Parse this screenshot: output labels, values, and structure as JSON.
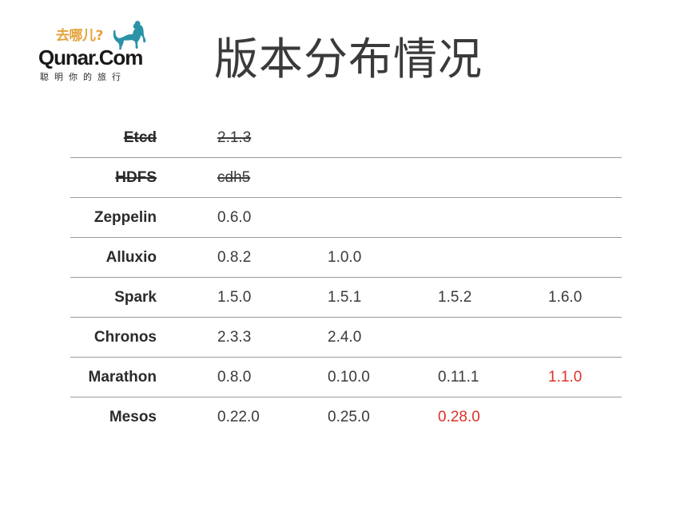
{
  "logo": {
    "slogan_cn": "去哪儿?",
    "wordmark": "Qunar.Com",
    "tagline": "聪明你的旅行",
    "camel_color": "#2a93a8",
    "slogan_color": "#e3a33c"
  },
  "header": {
    "title": "版本分布情况",
    "title_color": "#3a3a3a"
  },
  "colors": {
    "background": "#ffffff",
    "rule": "#9a9a9a",
    "text": "#3a3a3a",
    "label": "#2b2b2b",
    "highlight": "#e03127"
  },
  "table": {
    "rows": [
      {
        "label": "Etcd",
        "label_struck": true,
        "cells": [
          {
            "text": "2.1.3",
            "struck": true,
            "highlight": false
          },
          {
            "text": "",
            "struck": false,
            "highlight": false
          },
          {
            "text": "",
            "struck": false,
            "highlight": false
          },
          {
            "text": "",
            "struck": false,
            "highlight": false
          }
        ]
      },
      {
        "label": "HDFS",
        "label_struck": true,
        "cells": [
          {
            "text": "cdh5",
            "struck": true,
            "highlight": false
          },
          {
            "text": "",
            "struck": false,
            "highlight": false
          },
          {
            "text": "",
            "struck": false,
            "highlight": false
          },
          {
            "text": "",
            "struck": false,
            "highlight": false
          }
        ]
      },
      {
        "label": "Zeppelin",
        "label_struck": false,
        "cells": [
          {
            "text": "0.6.0",
            "struck": false,
            "highlight": false
          },
          {
            "text": "",
            "struck": false,
            "highlight": false
          },
          {
            "text": "",
            "struck": false,
            "highlight": false
          },
          {
            "text": "",
            "struck": false,
            "highlight": false
          }
        ]
      },
      {
        "label": "Alluxio",
        "label_struck": false,
        "cells": [
          {
            "text": "0.8.2",
            "struck": false,
            "highlight": false
          },
          {
            "text": "1.0.0",
            "struck": false,
            "highlight": false
          },
          {
            "text": "",
            "struck": false,
            "highlight": false
          },
          {
            "text": "",
            "struck": false,
            "highlight": false
          }
        ]
      },
      {
        "label": "Spark",
        "label_struck": false,
        "cells": [
          {
            "text": "1.5.0",
            "struck": false,
            "highlight": false
          },
          {
            "text": "1.5.1",
            "struck": false,
            "highlight": false
          },
          {
            "text": "1.5.2",
            "struck": false,
            "highlight": false
          },
          {
            "text": "1.6.0",
            "struck": false,
            "highlight": false
          }
        ]
      },
      {
        "label": "Chronos",
        "label_struck": false,
        "cells": [
          {
            "text": "2.3.3",
            "struck": false,
            "highlight": false
          },
          {
            "text": "2.4.0",
            "struck": false,
            "highlight": false
          },
          {
            "text": "",
            "struck": false,
            "highlight": false
          },
          {
            "text": "",
            "struck": false,
            "highlight": false
          }
        ]
      },
      {
        "label": "Marathon",
        "label_struck": false,
        "cells": [
          {
            "text": "0.8.0",
            "struck": false,
            "highlight": false
          },
          {
            "text": "0.10.0",
            "struck": false,
            "highlight": false
          },
          {
            "text": "0.11.1",
            "struck": false,
            "highlight": false
          },
          {
            "text": "1.1.0",
            "struck": false,
            "highlight": true
          }
        ]
      },
      {
        "label": "Mesos",
        "label_struck": false,
        "cells": [
          {
            "text": "0.22.0",
            "struck": false,
            "highlight": false
          },
          {
            "text": "0.25.0",
            "struck": false,
            "highlight": false
          },
          {
            "text": "0.28.0",
            "struck": false,
            "highlight": true
          },
          {
            "text": "",
            "struck": false,
            "highlight": false
          }
        ]
      }
    ]
  }
}
